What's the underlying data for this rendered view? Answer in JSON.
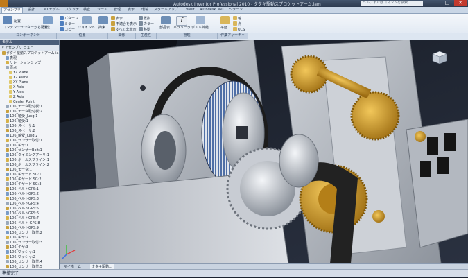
{
  "title_bar": {
    "window_title": "Autodesk Inventor Professional 2010 - タタキ駆動スプロケットアーム.iam",
    "help_search": "ヘルプまたはコマンドを検索",
    "minimize": "–",
    "restore": "□",
    "close": "✕"
  },
  "ribbon_tabs": [
    "アセンブリ",
    "設計",
    "3D モデル",
    "スケッチ",
    "検査",
    "ツール",
    "管理",
    "表示",
    "環境",
    "スタートアップ",
    "Vault",
    "Autodesk 360",
    "E-ラーン"
  ],
  "ribbon": {
    "groups": [
      "コンポーネント",
      "位置",
      "関係",
      "生産性",
      "管理",
      "作業フィーチャ"
    ],
    "buttons": {
      "place": "配置",
      "create": "作成",
      "place_cc": "コンテンツセンターから配置",
      "pattern": "パターン",
      "mirror": "ミラー",
      "copy": "コピー",
      "joint": "ジョイント",
      "constrain": "拘束",
      "show": "表示",
      "show_sick": "不適合を表示",
      "hide_all": "すべて非表示",
      "bom": "部品表",
      "param": "パラメータ",
      "plane": "平面",
      "axis": "軸",
      "point": "点",
      "ucs": "UCS",
      "replace": "置換",
      "move": "移動",
      "rotate": "回転",
      "bolt": "ボルト締結",
      "change_color": "カラー"
    }
  },
  "browser": {
    "header": "モデル",
    "toolbar_label": "アセンブリ ビュー",
    "nodes": [
      {
        "label": "タタキ駆動スプロケットアーム.iam",
        "level": 0
      },
      {
        "label": "表現",
        "level": 1
      },
      {
        "label": "リレーションシップ",
        "level": 1
      },
      {
        "label": "原点",
        "level": 1
      },
      {
        "label": "YZ Plane",
        "level": 2
      },
      {
        "label": "XZ Plane",
        "level": 2
      },
      {
        "label": "XY Plane",
        "level": 2
      },
      {
        "label": "X Axis",
        "level": 2
      },
      {
        "label": "Y Axis",
        "level": 2
      },
      {
        "label": "Z Axis",
        "level": 2
      },
      {
        "label": "Center Point",
        "level": 2
      },
      {
        "label": "106_モータ取付板:1",
        "level": 1
      },
      {
        "label": "106_モータ取付板:2",
        "level": 1
      },
      {
        "label": "106_軸受_Jung:1",
        "level": 1
      },
      {
        "label": "106_軸受:1",
        "level": 1
      },
      {
        "label": "106_スペーサ:1",
        "level": 1
      },
      {
        "label": "106_スペーサ:2",
        "level": 1
      },
      {
        "label": "106_軸受_Jung:2",
        "level": 1
      },
      {
        "label": "106_センサー取付:1",
        "level": 1
      },
      {
        "label": "106_ギヤ:1",
        "level": 1
      },
      {
        "label": "106_センサーBolt:1",
        "level": 1
      },
      {
        "label": "106_タイミングプーリ:1",
        "level": 1
      },
      {
        "label": "106_ボールスプライン:1",
        "level": 1
      },
      {
        "label": "106_ボールスプライン:2",
        "level": 1
      },
      {
        "label": "106_モータ:1",
        "level": 1
      },
      {
        "label": "106_ギヤード SG:1",
        "level": 1
      },
      {
        "label": "106_ギヤード SG:2",
        "level": 1
      },
      {
        "label": "106_ギヤード SG:3",
        "level": 1
      },
      {
        "label": "106_ベルトGPS:1",
        "level": 1
      },
      {
        "label": "106_ベルトGPS:2",
        "level": 1
      },
      {
        "label": "106_ベルトGPS:3",
        "level": 1
      },
      {
        "label": "106_ベルトGPS:4",
        "level": 1
      },
      {
        "label": "106_ベルトGPS:5",
        "level": 1
      },
      {
        "label": "106_ベルトGPS:6",
        "level": 1
      },
      {
        "label": "106_ベルトGPS:7",
        "level": 1
      },
      {
        "label": "106_ベルト GPS:8",
        "level": 1
      },
      {
        "label": "106_ベルトGPS:9",
        "level": 1
      },
      {
        "label": "106_センサー取付:2",
        "level": 1
      },
      {
        "label": "106_ギヤ:2",
        "level": 1
      },
      {
        "label": "106_センサー取付:3",
        "level": 1
      },
      {
        "label": "106_ギヤ:3",
        "level": 1
      },
      {
        "label": "106_ワッシャ:1",
        "level": 1
      },
      {
        "label": "106_ワッシャ:2",
        "level": 1
      },
      {
        "label": "106_センサー取付:4",
        "level": 1
      },
      {
        "label": "106_センサー取付:5",
        "level": 1
      }
    ]
  },
  "view_tabs": [
    "マイホーム",
    "タタキ駆動..."
  ],
  "status": "準備完了",
  "colors": {
    "accent": "#c07a1a",
    "gear_gold": "#c8941f",
    "plate_gray": "#b9bec6",
    "belt_dark": "#2a2a2a"
  },
  "icons": {
    "app_menu": "app-menu-icon",
    "viewcube": "viewcube-icon"
  }
}
